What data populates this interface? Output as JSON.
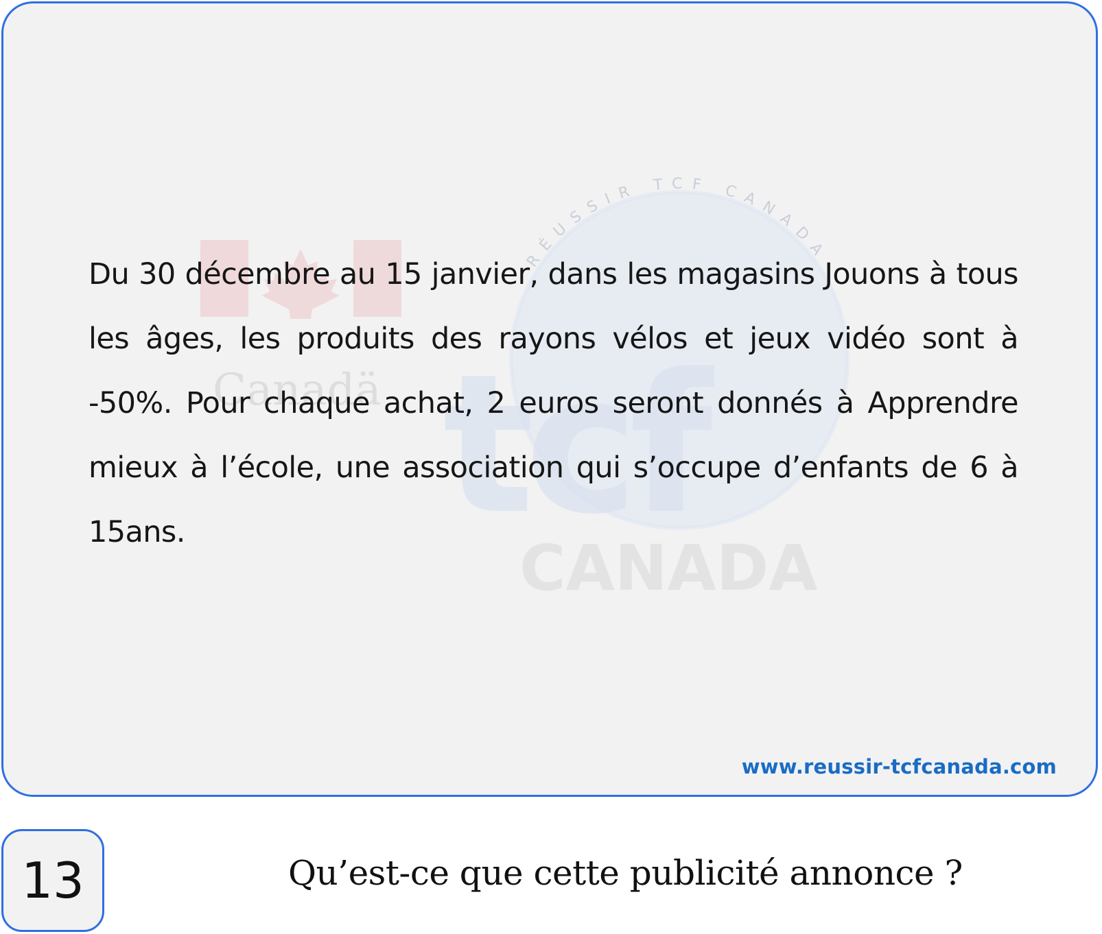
{
  "card": {
    "passage": "Du 30 décembre au 15 janvier, dans les magasins Jouons à tous les âges, les produits des rayons vélos et jeux vidéo sont à -50%. Pour chaque achat, 2 euros seront donnés à Apprendre mieux à l’école, une association qui s’occupe d’enfants de 6 à 15ans.",
    "website": "www.reussir-tcfcanada.com",
    "watermark": {
      "logo_text": "tcf",
      "logo_subtext": "CANADA",
      "ring_text": "RÉUSSIR TCF CANADA",
      "wordmark": "Canadä"
    }
  },
  "question": {
    "number": "13",
    "text": "Qu’est-ce que cette publicité annonce ?"
  },
  "colors": {
    "border": "#2f6fe0",
    "card_background": "#f2f2f3",
    "website_link": "#1a6cc4",
    "text": "#161616"
  }
}
